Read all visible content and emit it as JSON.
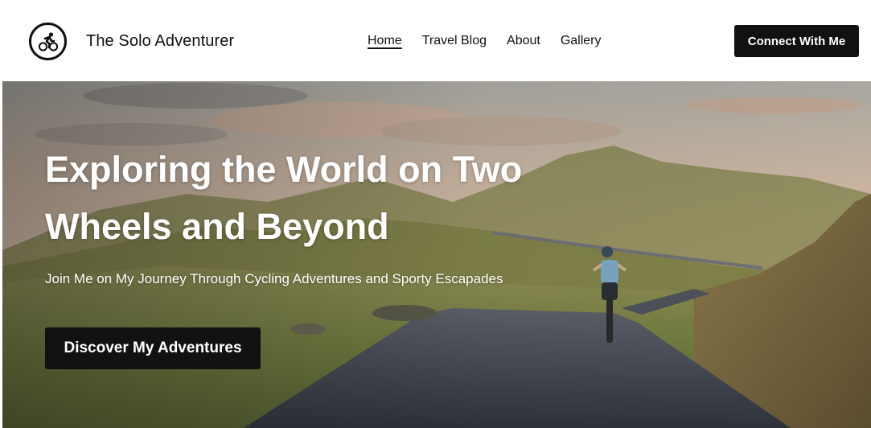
{
  "header": {
    "brand_name": "The Solo Adventurer",
    "logo_icon": "cyclist-icon",
    "nav": [
      {
        "label": "Home",
        "active": true
      },
      {
        "label": "Travel Blog",
        "active": false
      },
      {
        "label": "About",
        "active": false
      },
      {
        "label": "Gallery",
        "active": false
      }
    ],
    "cta_label": "Connect With Me"
  },
  "hero": {
    "title": "Exploring the World on Two Wheels and Beyond",
    "subtitle": "Join Me on My Journey Through Cycling Adventures and Sporty Escapades",
    "cta_label": "Discover My Adventures",
    "image": "cyclist-on-mountain-road"
  },
  "colors": {
    "primary": "#111111",
    "background": "#ffffff",
    "hero_text": "#ffffff"
  }
}
